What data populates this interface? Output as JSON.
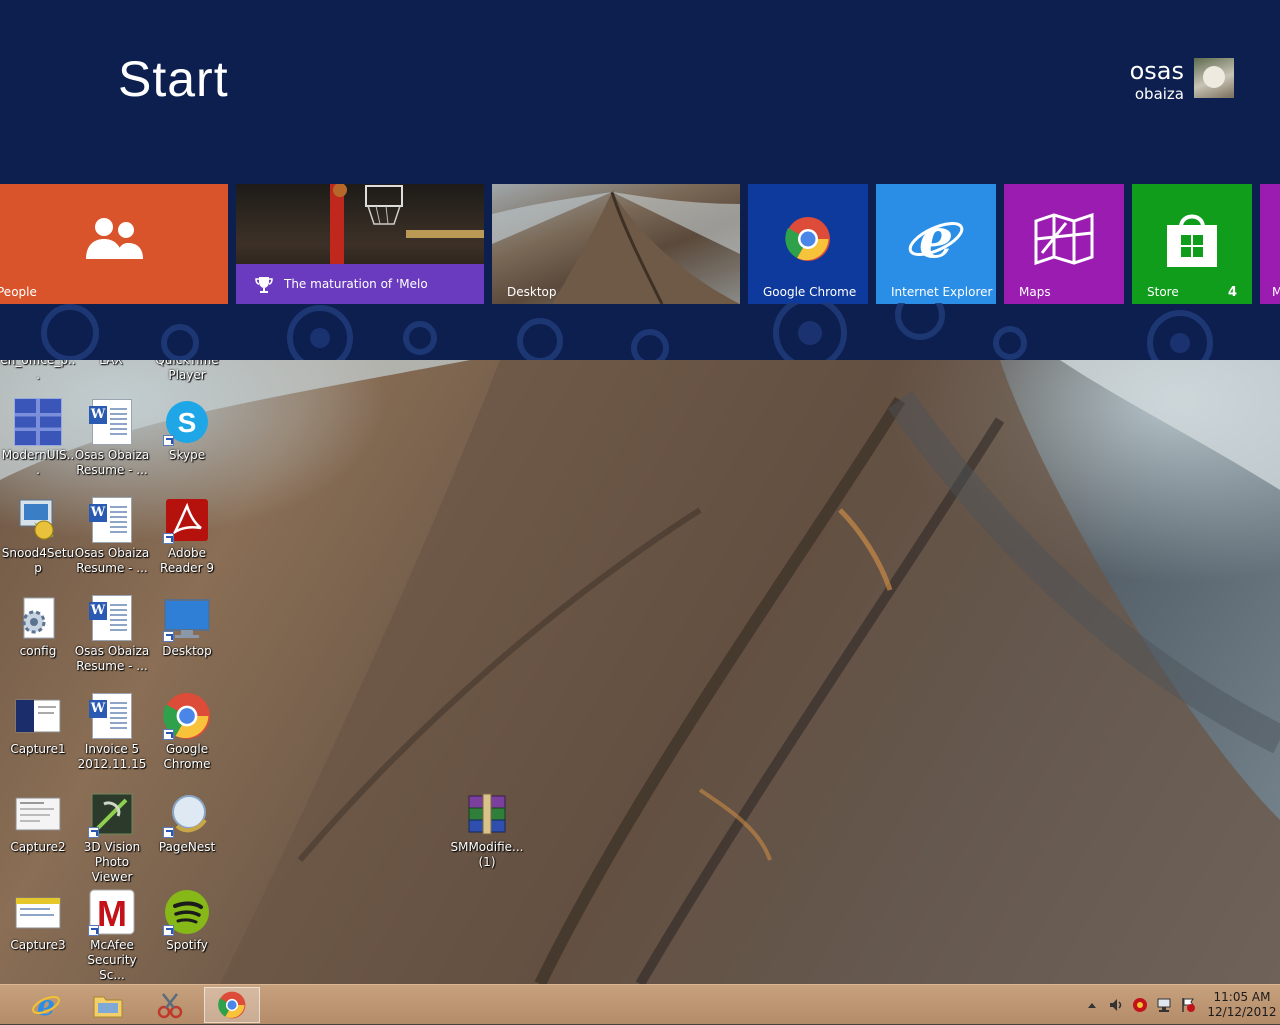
{
  "start": {
    "title": "Start",
    "user": {
      "first_name": "osas",
      "last_name": "obaiza"
    }
  },
  "tiles": {
    "people": {
      "label": "People"
    },
    "sports": {
      "headline": "The maturation of 'Melo"
    },
    "desktop": {
      "label": "Desktop"
    },
    "chrome": {
      "label": "Google Chrome"
    },
    "ie": {
      "label": "Internet Explorer"
    },
    "maps": {
      "label": "Maps"
    },
    "store": {
      "label": "Store",
      "badge": "4"
    },
    "partial": {
      "label": "M"
    }
  },
  "desktop_icons": {
    "top_partial": [
      "en_office_p...",
      "LAX",
      "QuickTime Player"
    ],
    "modernuis": "ModernUIS...",
    "resume1": "Osas Obaiza Resume - ...",
    "skype": "Skype",
    "snood": "Snood4Setup",
    "resume2": "Osas Obaiza Resume - ...",
    "adobe": "Adobe Reader 9",
    "config": "config",
    "resume3": "Osas Obaiza Resume - ...",
    "desktop": "Desktop",
    "capture1": "Capture1",
    "invoice": "Invoice 5 2012.11.15",
    "chrome": "Google Chrome",
    "capture2": "Capture2",
    "vision": "3D Vision Photo Viewer",
    "pagenest": "PageNest",
    "capture3": "Capture3",
    "mcafee": "McAfee Security Sc...",
    "spotify": "Spotify",
    "smmodifier": "SMModifie... (1)"
  },
  "taskbar": {
    "clock_time": "11:05 AM",
    "clock_date": "12/12/2012"
  },
  "colors": {
    "start_bg": "#0c1f4f",
    "people": "#d9532b",
    "sports_bar": "#6a3bbf",
    "chrome_tile": "#0d3a9c",
    "ie_tile": "#2a8ee6",
    "maps_tile": "#9a1cb0",
    "store_tile": "#109d1c",
    "taskbar": "#b48c69"
  }
}
